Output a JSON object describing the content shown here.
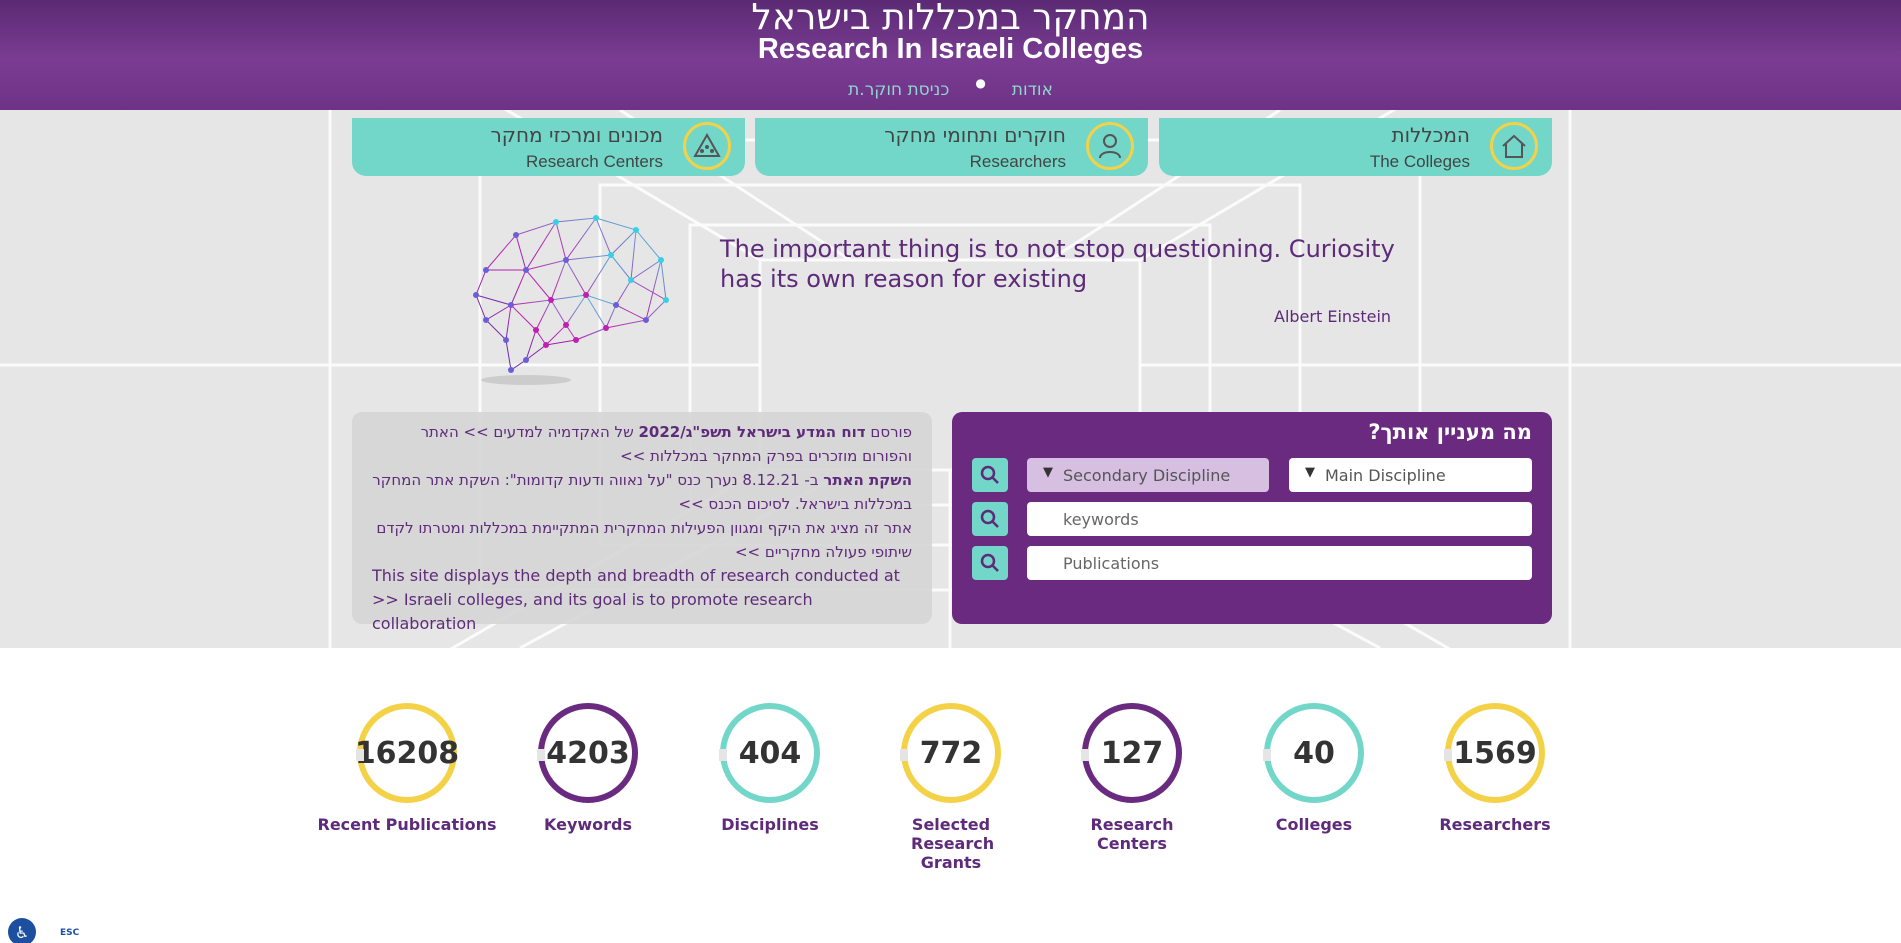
{
  "header": {
    "title_he": "המחקר במכללות בישראל",
    "title_en": "Research In Israeli Colleges",
    "nav": [
      {
        "label": "אודות"
      },
      {
        "label": "כניסת חוקר.ת"
      }
    ]
  },
  "categories": [
    {
      "he": "המכללות",
      "en": "The Colleges",
      "icon": "home-icon"
    },
    {
      "he": "חוקרים ותחומי מחקר",
      "en": "Researchers",
      "icon": "person-icon"
    },
    {
      "he": "מכונים ומרכזי מחקר",
      "en": "Research Centers",
      "icon": "network-icon"
    }
  ],
  "quote": {
    "text": "The important thing is to not stop questioning. Curiosity has its own reason for existing",
    "author": "Albert Einstein"
  },
  "news": {
    "line1_pre": "פורסם",
    "line1_bold": "דוח המדע בישראל תשפ\"ג/2022",
    "line1_post": "של האקדמיה למדעים >> האתר והפורום מוזכרים בפרק המחקר במכללות >>",
    "line2_bold": "השקת האתר",
    "line2_post": "ב- 8.12.21 נערך כנס \"על נאווה ודעות קדומות\": השקת אתר המחקר במכללות בישראל. לסיכום הכנס  >>",
    "line3": "אתר זה מציג את היקף ומגוון הפעילות המחקרית המתקיימת במכללות ומטרתו לקדם שיתופי פעולה מחקריים >>",
    "line4": "This site displays the depth and breadth of research conducted at >> Israeli colleges, and its goal is to promote research collaboration"
  },
  "search": {
    "title": "מה מעניין אותך?",
    "main_discipline": "Main Discipline",
    "secondary_discipline": "Secondary Discipline",
    "keywords_placeholder": "keywords",
    "publications_placeholder": "Publications"
  },
  "stats": [
    {
      "value": "16208",
      "label": "Recent Publications",
      "color": "#f3d247"
    },
    {
      "value": "4203",
      "label": "Keywords",
      "color": "#6a2a7f"
    },
    {
      "value": "404",
      "label": "Disciplines",
      "color": "#72d7c9"
    },
    {
      "value": "772",
      "label": "Selected Research Grants",
      "color": "#f3d247"
    },
    {
      "value": "127",
      "label": "Research Centers",
      "color": "#6a2a7f"
    },
    {
      "value": "40",
      "label": "Colleges",
      "color": "#72d7c9"
    },
    {
      "value": "1569",
      "label": "Researchers",
      "color": "#f3d247"
    }
  ],
  "accessibility": {
    "esc_label": "ESC"
  },
  "colors": {
    "purple": "#6a2a7f",
    "teal": "#72d7c9",
    "yellow": "#f3d247"
  }
}
